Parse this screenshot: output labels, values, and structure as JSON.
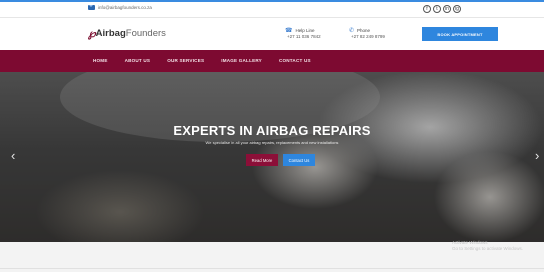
{
  "topbar": {
    "email": "info@airbagfounders.co.za",
    "socials": [
      "f",
      "t",
      "in",
      "ig"
    ]
  },
  "header": {
    "logo_mark": "℘",
    "logo_bold": "Airbag",
    "logo_light": " Founders",
    "helpline_label": "Help Line",
    "helpline_value": "+27 11 036 7842",
    "phone_label": "Phone",
    "phone_value": "+27 82 249 8799",
    "cta_label": "BOOK APPOINTMENT"
  },
  "nav": {
    "items": [
      "HOME",
      "ABOUT US",
      "OUR SERVICES",
      "IMAGE GALLERY",
      "CONTACT US"
    ]
  },
  "hero": {
    "headline": "EXPERTS IN AIRBAG REPAIRS",
    "subline": "We specialise in all your airbag repairs, replacements and new installations",
    "read_more": "Read More",
    "contact_us": "Contact Us",
    "prev_arrow": "‹",
    "next_arrow": "›"
  },
  "watermark": {
    "line1": "Activate Windows",
    "line2": "Go to Settings to activate Windows."
  },
  "colors": {
    "nav_bg": "#7d0a31",
    "accent_blue": "#2e86de",
    "brand_maroon": "#8c0f38"
  }
}
